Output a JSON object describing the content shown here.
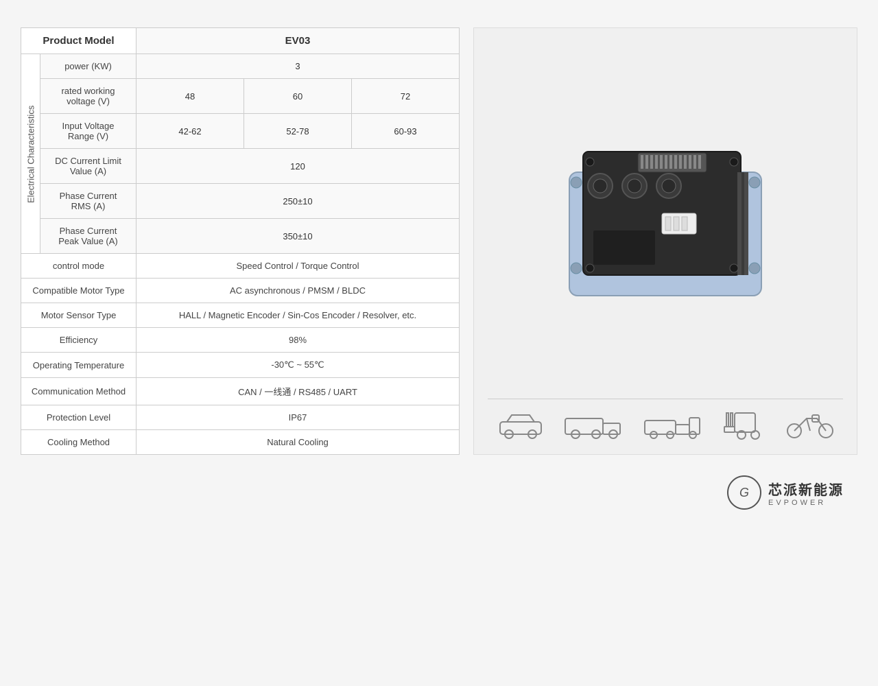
{
  "table": {
    "header": {
      "label": "Product Model",
      "value": "EV03"
    },
    "electrical_label": "Electrical Characteristics",
    "rows": [
      {
        "sub_label": "power (KW)",
        "cells": [
          {
            "value": "3",
            "colspan": 3
          }
        ]
      },
      {
        "sub_label": "rated working voltage (V)",
        "cells": [
          {
            "value": "48"
          },
          {
            "value": "60"
          },
          {
            "value": "72"
          }
        ]
      },
      {
        "sub_label": "Input Voltage Range (V)",
        "cells": [
          {
            "value": "42-62"
          },
          {
            "value": "52-78"
          },
          {
            "value": "60-93"
          }
        ]
      },
      {
        "sub_label": "DC Current Limit Value (A)",
        "cells": [
          {
            "value": "120",
            "colspan": 3
          }
        ]
      },
      {
        "sub_label": "Phase Current RMS (A)",
        "cells": [
          {
            "value": "250±10",
            "colspan": 3
          }
        ]
      },
      {
        "sub_label": "Phase Current Peak Value (A)",
        "cells": [
          {
            "value": "350±10",
            "colspan": 3
          }
        ]
      }
    ],
    "category_rows": [
      {
        "label": "control mode",
        "value": "Speed Control / Torque Control"
      },
      {
        "label": "Compatible Motor Type",
        "value": "AC asynchronous  /  PMSM / BLDC"
      },
      {
        "label": "Motor Sensor Type",
        "value": "HALL / Magnetic Encoder / Sin-Cos Encoder / Resolver, etc."
      },
      {
        "label": "Efficiency",
        "value": "98%"
      },
      {
        "label": "Operating Temperature",
        "value": "-30℃ ~ 55℃"
      },
      {
        "label": "Communication Method",
        "value": "CAN / 一线通 / RS485 / UART"
      },
      {
        "label": "Protection Level",
        "value": "IP67"
      },
      {
        "label": "Cooling Method",
        "value": "Natural Cooling"
      }
    ]
  },
  "logo": {
    "chinese": "芯派新能源",
    "english": "EVPOWER",
    "icon": "G"
  },
  "vehicles": [
    "🚗",
    "🚛",
    "🚚",
    "🚜",
    "🏍️"
  ]
}
